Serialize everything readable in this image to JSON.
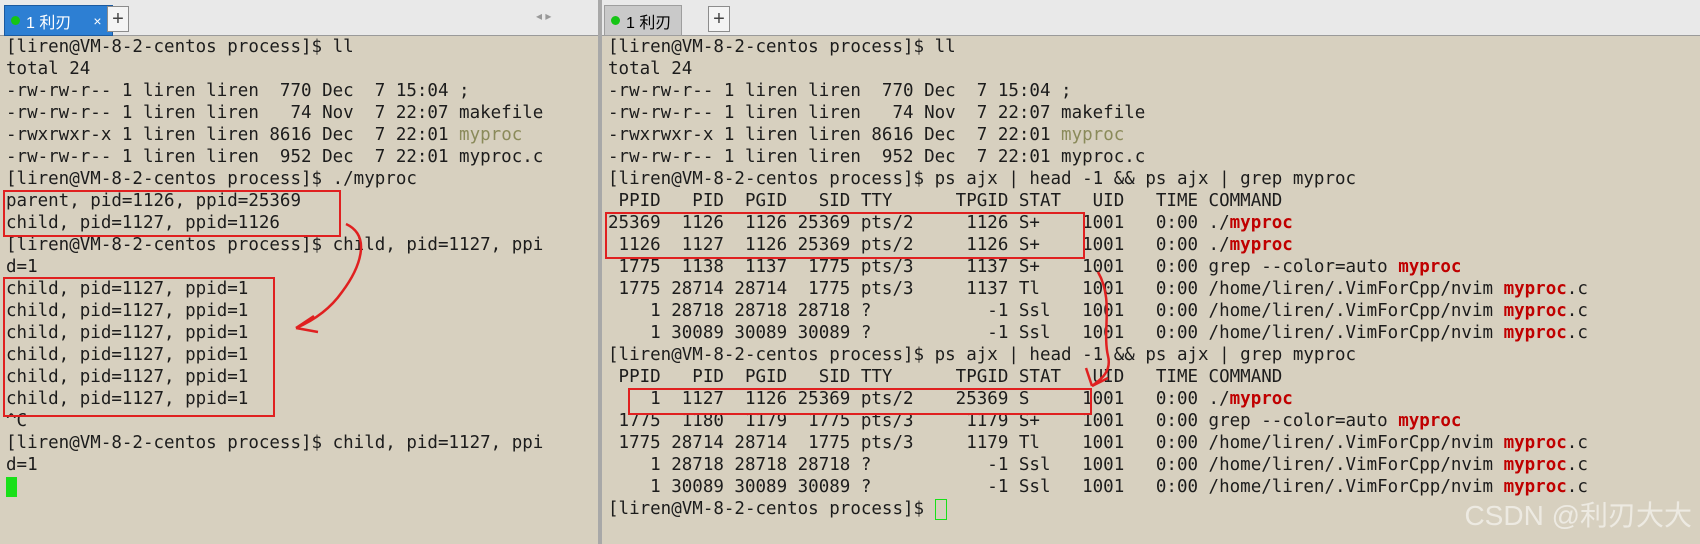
{
  "left": {
    "tab_label": "1 利刃",
    "close_glyph": "×",
    "add_glyph": "+",
    "nav_glyph": "◂ ▸",
    "lines": [
      "[liren@VM-8-2-centos process]$ ll",
      "total 24",
      "-rw-rw-r-- 1 liren liren  770 Dec  7 15:04 ;",
      "-rw-rw-r-- 1 liren liren   74 Nov  7 22:07 makefile",
      "-rwxrwxr-x 1 liren liren 8616 Dec  7 22:01 ",
      "-rw-rw-r-- 1 liren liren  952 Dec  7 22:01 myproc.c",
      "[liren@VM-8-2-centos process]$ ./myproc",
      "parent, pid=1126, ppid=25369",
      "child, pid=1127, ppid=1126",
      "[liren@VM-8-2-centos process]$ child, pid=1127, ppi",
      "d=1",
      "child, pid=1127, ppid=1",
      "child, pid=1127, ppid=1",
      "child, pid=1127, ppid=1",
      "child, pid=1127, ppid=1",
      "child, pid=1127, ppid=1",
      "child, pid=1127, ppid=1",
      "^C",
      "[liren@VM-8-2-centos process]$ child, pid=1127, ppi",
      "d=1"
    ],
    "exec_name": "myproc"
  },
  "right": {
    "tab_label": "1 利刃",
    "add_glyph": "+",
    "lines": [
      "[liren@VM-8-2-centos process]$ ll",
      "total 24",
      "-rw-rw-r-- 1 liren liren  770 Dec  7 15:04 ;",
      "-rw-rw-r-- 1 liren liren   74 Nov  7 22:07 makefile",
      "-rwxrwxr-x 1 liren liren 8616 Dec  7 22:01 ",
      "-rw-rw-r-- 1 liren liren  952 Dec  7 22:01 myproc.c",
      "[liren@VM-8-2-centos process]$ ps ajx | head -1 && ps ajx | grep myproc",
      " PPID   PID  PGID   SID TTY      TPGID STAT   UID   TIME COMMAND",
      "25369  1126  1126 25369 pts/2     1126 S+    1001   0:00 ./",
      " 1126  1127  1126 25369 pts/2     1126 S+    1001   0:00 ./",
      " 1775  1138  1137  1775 pts/3     1137 S+    1001   0:00 grep --color=auto ",
      " 1775 28714 28714  1775 pts/3     1137 Tl    1001   0:00 /home/liren/.VimForCpp/nvim ",
      "    1 28718 28718 28718 ?           -1 Ssl   1001   0:00 /home/liren/.VimForCpp/nvim ",
      "    1 30089 30089 30089 ?           -1 Ssl   1001   0:00 /home/liren/.VimForCpp/nvim ",
      "[liren@VM-8-2-centos process]$ ps ajx | head -1 && ps ajx | grep myproc",
      " PPID   PID  PGID   SID TTY      TPGID STAT   UID   TIME COMMAND",
      "    1  1127  1126 25369 pts/2    25369 S     1001   0:00 ./",
      " 1775  1180  1179  1775 pts/3     1179 S+    1001   0:00 grep --color=auto ",
      " 1775 28714 28714  1775 pts/3     1179 Tl    1001   0:00 /home/liren/.VimForCpp/nvim ",
      "    1 28718 28718 28718 ?           -1 Ssl   1001   0:00 /home/liren/.VimForCpp/nvim ",
      "    1 30089 30089 30089 ?           -1 Ssl   1001   0:00 /home/liren/.VimForCpp/nvim ",
      "[liren@VM-8-2-centos process]$ "
    ],
    "exec_name": "myproc",
    "match_word": "myproc",
    "suffix_c": ".c"
  },
  "watermark": "CSDN @利刃大大"
}
